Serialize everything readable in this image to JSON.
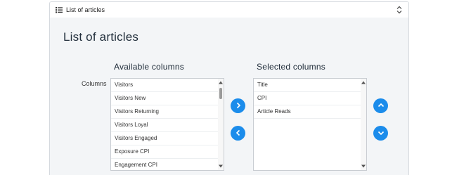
{
  "panel": {
    "header_title": "List of articles",
    "list_icon": "list-icon",
    "toggle_icon": "chevron-up-down-icon"
  },
  "page": {
    "title": "List of articles",
    "field_label": "Columns"
  },
  "available": {
    "heading": "Available columns",
    "items": [
      "Visitors",
      "Visitors New",
      "Visitors Returning",
      "Visitors Loyal",
      "Visitors Engaged",
      "Exposure CPI",
      "Engagement CPI"
    ]
  },
  "selected": {
    "heading": "Selected columns",
    "items": [
      "Title",
      "CPI",
      "Article Reads"
    ]
  },
  "buttons": {
    "add_icon": "chevron-right-icon",
    "remove_icon": "chevron-left-icon",
    "move_up_icon": "chevron-up-icon",
    "move_down_icon": "chevron-down-icon"
  },
  "colors": {
    "accent": "#1b8ceb",
    "heading": "#222f3c",
    "panel_body": "#f3f5f7"
  }
}
